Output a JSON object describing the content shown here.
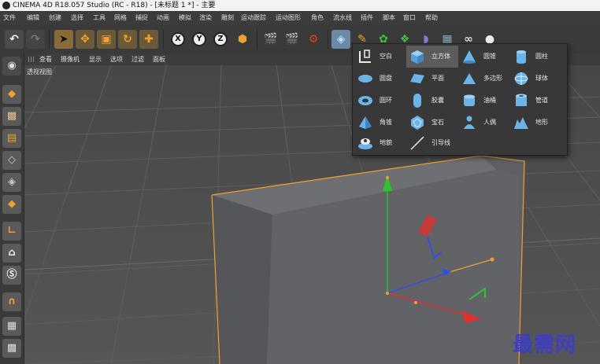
{
  "window": {
    "title": "CINEMA 4D R18.057 Studio (RC - R18) - [未标题 1 *] - 主要"
  },
  "menu": [
    "文件",
    "编辑",
    "创建",
    "选择",
    "工具",
    "网格",
    "捕捉",
    "动画",
    "模拟",
    "渲染",
    "雕刻",
    "运动跟踪",
    "运动图形",
    "角色",
    "流水线",
    "插件",
    "脚本",
    "窗口",
    "帮助"
  ],
  "toolbar": {
    "undo": "undo-icon",
    "redo": "redo-icon",
    "select": "cursor-icon",
    "move": "move-icon",
    "scale": "scale-icon",
    "rotate": "rotate-icon",
    "add": "plus-icon",
    "x": "X",
    "y": "Y",
    "z": "Z",
    "coord": "coordinate-system-icon",
    "render_view": "render-view-icon",
    "render_picture": "render-picture-icon",
    "render_settings": "render-settings-icon",
    "cube": "cube-icon",
    "pen": "pen-icon",
    "subdivision": "subdivision-icon",
    "array": "array-icon",
    "deformer": "deformer-icon",
    "floor": "floor-icon",
    "camera": "camera-icon",
    "light": "light-icon"
  },
  "viewport_menu": [
    "查看",
    "摄像机",
    "显示",
    "选项",
    "过滤",
    "面板"
  ],
  "viewport_label": "透视视图",
  "left_tools": [
    "make-editable-icon",
    "model-mode-icon",
    "texture-mode-icon",
    "workplane-icon",
    "points-mode-icon",
    "edges-mode-icon",
    "polygons-mode-icon",
    "axis-icon",
    "tweak-icon",
    "snap-icon",
    "magnet-icon",
    "soft-selection-icon",
    "lock-icon"
  ],
  "primitives_popup": {
    "selected": "立方体",
    "items": [
      {
        "label": "空白",
        "icon": "null-icon"
      },
      {
        "label": "立方体",
        "icon": "cube-icon"
      },
      {
        "label": "圆锥",
        "icon": "cone-icon"
      },
      {
        "label": "圆柱",
        "icon": "cylinder-icon"
      },
      {
        "label": "圆盘",
        "icon": "disc-icon"
      },
      {
        "label": "平面",
        "icon": "plane-icon"
      },
      {
        "label": "多边形",
        "icon": "polygon-icon"
      },
      {
        "label": "球体",
        "icon": "sphere-icon"
      },
      {
        "label": "圆环",
        "icon": "torus-icon"
      },
      {
        "label": "胶囊",
        "icon": "capsule-icon"
      },
      {
        "label": "油桶",
        "icon": "oil-tank-icon"
      },
      {
        "label": "管道",
        "icon": "tube-icon"
      },
      {
        "label": "角锥",
        "icon": "pyramid-icon"
      },
      {
        "label": "宝石",
        "icon": "platonic-icon"
      },
      {
        "label": "人偶",
        "icon": "figure-icon"
      },
      {
        "label": "地形",
        "icon": "landscape-icon"
      },
      {
        "label": "地貌",
        "icon": "relief-icon"
      },
      {
        "label": "引导线",
        "icon": "guide-icon"
      }
    ]
  },
  "colors": {
    "accent": "#f0a030",
    "axis_x": "#e03030",
    "axis_y": "#30c030",
    "axis_z": "#3050e0",
    "icon_blue": "#6ab4e8"
  },
  "watermark": "最需网"
}
